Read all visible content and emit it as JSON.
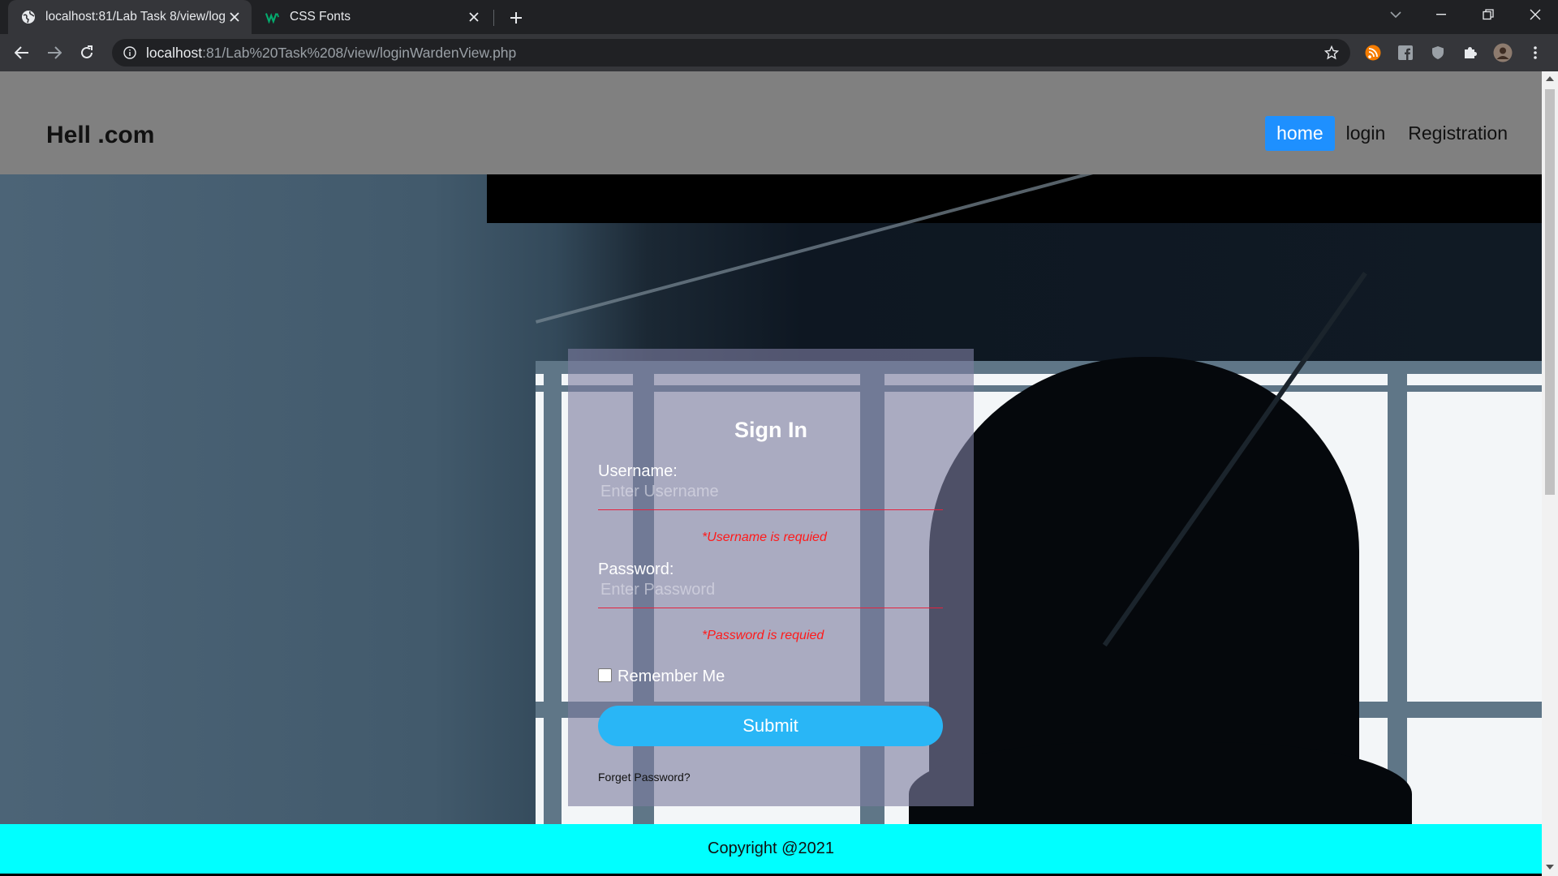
{
  "browser": {
    "tabs": [
      {
        "title": "localhost:81/Lab Task 8/view/login",
        "active": true,
        "favicon": "globe-icon"
      },
      {
        "title": "CSS Fonts",
        "active": false,
        "favicon": "w3schools-icon"
      }
    ],
    "url_host": "localhost",
    "url_rest": ":81/Lab%20Task%208/view/loginWardenView.php"
  },
  "site": {
    "logo": "Hell .com",
    "nav": [
      {
        "label": "home",
        "active": true
      },
      {
        "label": "login",
        "active": false
      },
      {
        "label": "Registration",
        "active": false
      }
    ]
  },
  "form": {
    "title": "Sign In",
    "username_label": "Username:",
    "username_placeholder": "Enter Username",
    "username_error": "*Username is requied",
    "password_label": "Password:",
    "password_placeholder": "Enter Password",
    "password_error": "*Password is requied",
    "remember_label": "Remember Me",
    "submit_label": "Submit",
    "forget_label": "Forget Password?"
  },
  "footer": {
    "text": "Copyright @2021"
  },
  "colors": {
    "nav_active": "#1e90ff",
    "submit": "#29b6f6",
    "footer": "#00ffff",
    "error": "#ff1a1a"
  }
}
